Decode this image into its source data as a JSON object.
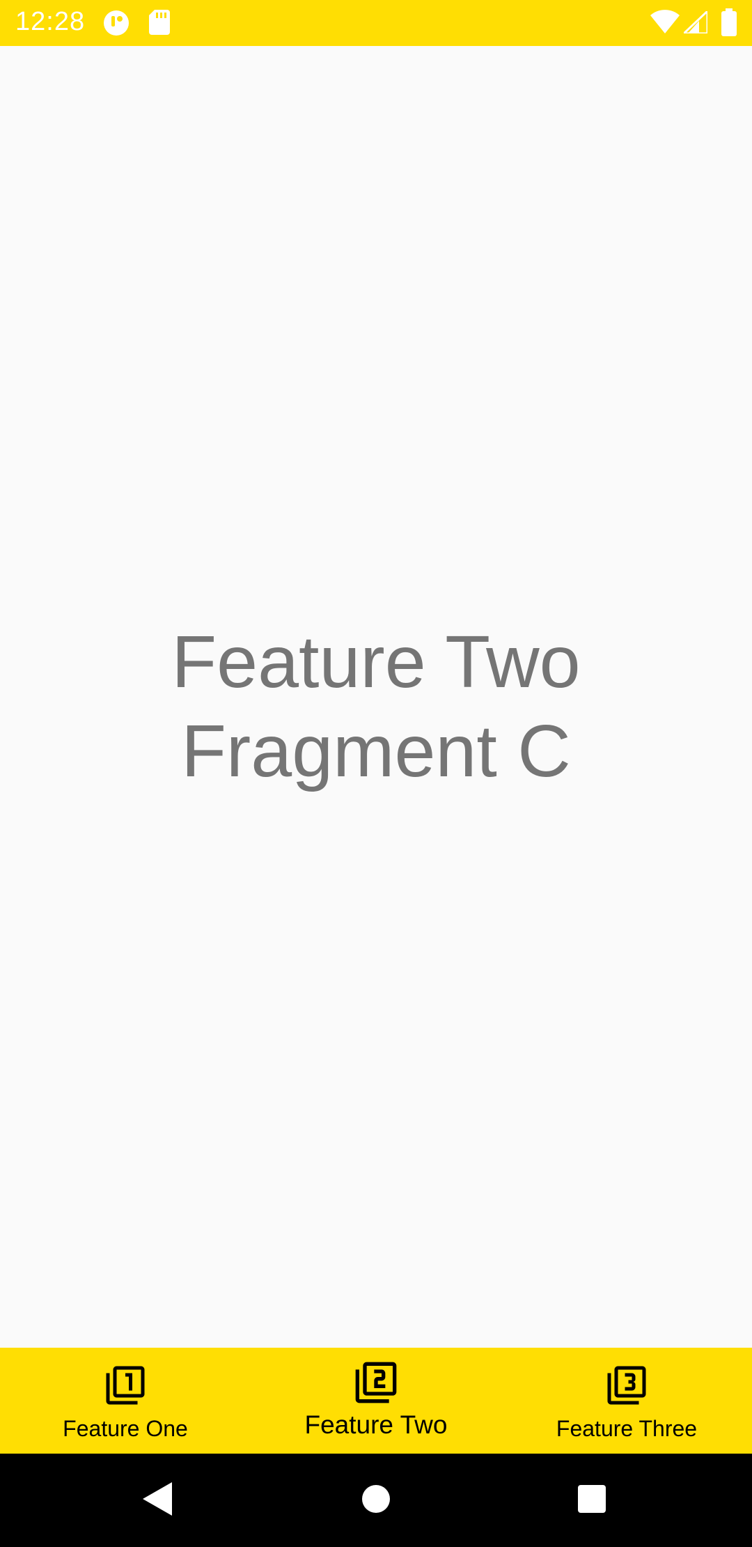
{
  "status_bar": {
    "time": "12:28",
    "background": "#ffde03",
    "icons": [
      "notification-app-icon",
      "sd-card-icon",
      "wifi-icon",
      "cellular-signal-icon",
      "battery-icon"
    ]
  },
  "content": {
    "line1": "Feature Two",
    "line2": "Fragment C",
    "text_color": "#757575"
  },
  "bottom_nav": {
    "background": "#ffde03",
    "selected_index": 1,
    "items": [
      {
        "label": "Feature One",
        "icon": "filter-1-icon"
      },
      {
        "label": "Feature Two",
        "icon": "filter-2-icon"
      },
      {
        "label": "Feature Three",
        "icon": "filter-3-icon"
      }
    ]
  },
  "system_nav": {
    "buttons": [
      "back-icon",
      "home-icon",
      "recents-icon"
    ]
  }
}
